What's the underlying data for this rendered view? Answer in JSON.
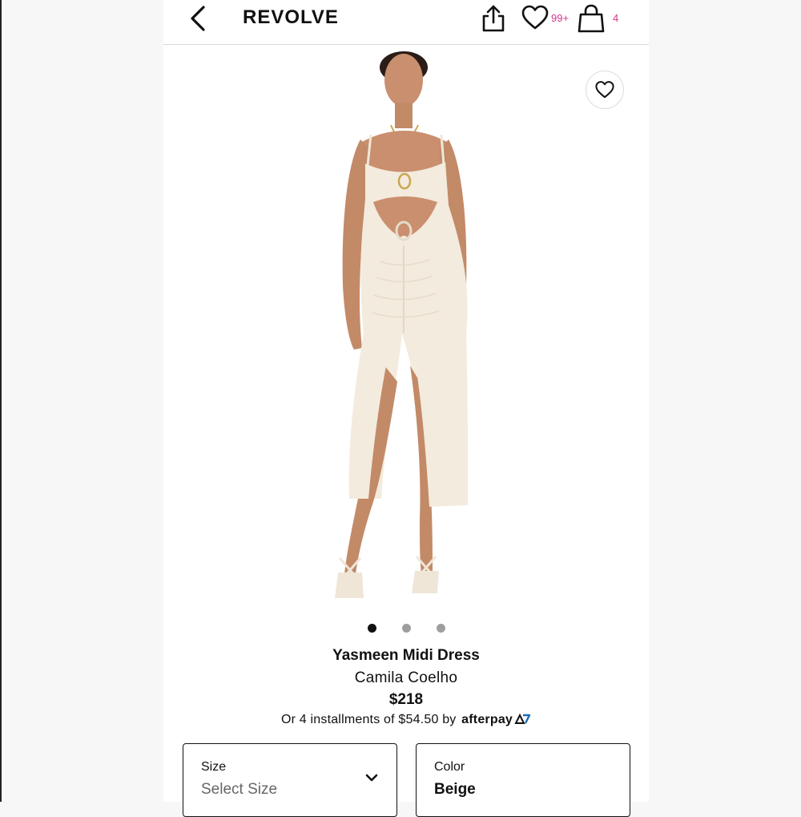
{
  "header": {
    "brand": "REVOLVE",
    "wishlist_count": "99+",
    "bag_count": "4",
    "icons": [
      "back-chevron-icon",
      "share-icon",
      "heart-icon",
      "shopping-bag-icon"
    ],
    "accent_color": "#d6338f"
  },
  "gallery": {
    "image_alt": "Model wearing cream cutout midi dress",
    "favorite_icon": "heart-icon",
    "image_count": 3,
    "active_index": 0
  },
  "product": {
    "title": "Yasmeen Midi Dress",
    "designer": "Camila Coelho",
    "price": "$218",
    "installments_text": "Or 4 installments of $54.50 by",
    "afterpay_label": "afterpay"
  },
  "options": {
    "size_label": "Size",
    "size_value": "Select Size",
    "color_label": "Color",
    "color_value": "Beige"
  }
}
